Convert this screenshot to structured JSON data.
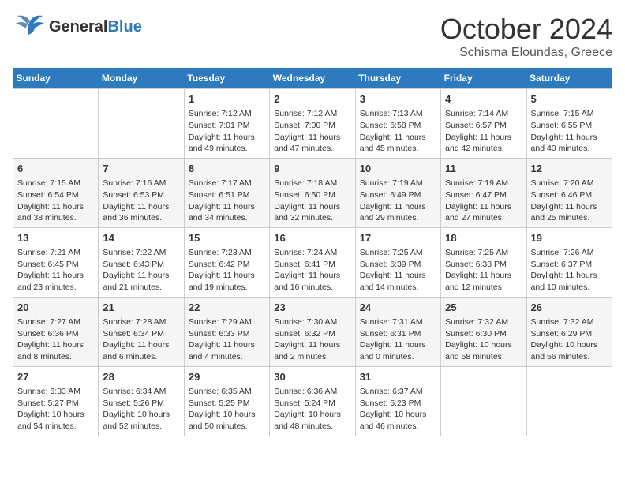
{
  "header": {
    "logo_general": "General",
    "logo_blue": "Blue",
    "month_title": "October 2024",
    "location": "Schisma Eloundas, Greece"
  },
  "weekdays": [
    "Sunday",
    "Monday",
    "Tuesday",
    "Wednesday",
    "Thursday",
    "Friday",
    "Saturday"
  ],
  "weeks": [
    [
      {
        "day": "",
        "sunrise": "",
        "sunset": "",
        "daylight": ""
      },
      {
        "day": "",
        "sunrise": "",
        "sunset": "",
        "daylight": ""
      },
      {
        "day": "1",
        "sunrise": "Sunrise: 7:12 AM",
        "sunset": "Sunset: 7:01 PM",
        "daylight": "Daylight: 11 hours and 49 minutes."
      },
      {
        "day": "2",
        "sunrise": "Sunrise: 7:12 AM",
        "sunset": "Sunset: 7:00 PM",
        "daylight": "Daylight: 11 hours and 47 minutes."
      },
      {
        "day": "3",
        "sunrise": "Sunrise: 7:13 AM",
        "sunset": "Sunset: 6:58 PM",
        "daylight": "Daylight: 11 hours and 45 minutes."
      },
      {
        "day": "4",
        "sunrise": "Sunrise: 7:14 AM",
        "sunset": "Sunset: 6:57 PM",
        "daylight": "Daylight: 11 hours and 42 minutes."
      },
      {
        "day": "5",
        "sunrise": "Sunrise: 7:15 AM",
        "sunset": "Sunset: 6:55 PM",
        "daylight": "Daylight: 11 hours and 40 minutes."
      }
    ],
    [
      {
        "day": "6",
        "sunrise": "Sunrise: 7:15 AM",
        "sunset": "Sunset: 6:54 PM",
        "daylight": "Daylight: 11 hours and 38 minutes."
      },
      {
        "day": "7",
        "sunrise": "Sunrise: 7:16 AM",
        "sunset": "Sunset: 6:53 PM",
        "daylight": "Daylight: 11 hours and 36 minutes."
      },
      {
        "day": "8",
        "sunrise": "Sunrise: 7:17 AM",
        "sunset": "Sunset: 6:51 PM",
        "daylight": "Daylight: 11 hours and 34 minutes."
      },
      {
        "day": "9",
        "sunrise": "Sunrise: 7:18 AM",
        "sunset": "Sunset: 6:50 PM",
        "daylight": "Daylight: 11 hours and 32 minutes."
      },
      {
        "day": "10",
        "sunrise": "Sunrise: 7:19 AM",
        "sunset": "Sunset: 6:49 PM",
        "daylight": "Daylight: 11 hours and 29 minutes."
      },
      {
        "day": "11",
        "sunrise": "Sunrise: 7:19 AM",
        "sunset": "Sunset: 6:47 PM",
        "daylight": "Daylight: 11 hours and 27 minutes."
      },
      {
        "day": "12",
        "sunrise": "Sunrise: 7:20 AM",
        "sunset": "Sunset: 6:46 PM",
        "daylight": "Daylight: 11 hours and 25 minutes."
      }
    ],
    [
      {
        "day": "13",
        "sunrise": "Sunrise: 7:21 AM",
        "sunset": "Sunset: 6:45 PM",
        "daylight": "Daylight: 11 hours and 23 minutes."
      },
      {
        "day": "14",
        "sunrise": "Sunrise: 7:22 AM",
        "sunset": "Sunset: 6:43 PM",
        "daylight": "Daylight: 11 hours and 21 minutes."
      },
      {
        "day": "15",
        "sunrise": "Sunrise: 7:23 AM",
        "sunset": "Sunset: 6:42 PM",
        "daylight": "Daylight: 11 hours and 19 minutes."
      },
      {
        "day": "16",
        "sunrise": "Sunrise: 7:24 AM",
        "sunset": "Sunset: 6:41 PM",
        "daylight": "Daylight: 11 hours and 16 minutes."
      },
      {
        "day": "17",
        "sunrise": "Sunrise: 7:25 AM",
        "sunset": "Sunset: 6:39 PM",
        "daylight": "Daylight: 11 hours and 14 minutes."
      },
      {
        "day": "18",
        "sunrise": "Sunrise: 7:25 AM",
        "sunset": "Sunset: 6:38 PM",
        "daylight": "Daylight: 11 hours and 12 minutes."
      },
      {
        "day": "19",
        "sunrise": "Sunrise: 7:26 AM",
        "sunset": "Sunset: 6:37 PM",
        "daylight": "Daylight: 11 hours and 10 minutes."
      }
    ],
    [
      {
        "day": "20",
        "sunrise": "Sunrise: 7:27 AM",
        "sunset": "Sunset: 6:36 PM",
        "daylight": "Daylight: 11 hours and 8 minutes."
      },
      {
        "day": "21",
        "sunrise": "Sunrise: 7:28 AM",
        "sunset": "Sunset: 6:34 PM",
        "daylight": "Daylight: 11 hours and 6 minutes."
      },
      {
        "day": "22",
        "sunrise": "Sunrise: 7:29 AM",
        "sunset": "Sunset: 6:33 PM",
        "daylight": "Daylight: 11 hours and 4 minutes."
      },
      {
        "day": "23",
        "sunrise": "Sunrise: 7:30 AM",
        "sunset": "Sunset: 6:32 PM",
        "daylight": "Daylight: 11 hours and 2 minutes."
      },
      {
        "day": "24",
        "sunrise": "Sunrise: 7:31 AM",
        "sunset": "Sunset: 6:31 PM",
        "daylight": "Daylight: 11 hours and 0 minutes."
      },
      {
        "day": "25",
        "sunrise": "Sunrise: 7:32 AM",
        "sunset": "Sunset: 6:30 PM",
        "daylight": "Daylight: 10 hours and 58 minutes."
      },
      {
        "day": "26",
        "sunrise": "Sunrise: 7:32 AM",
        "sunset": "Sunset: 6:29 PM",
        "daylight": "Daylight: 10 hours and 56 minutes."
      }
    ],
    [
      {
        "day": "27",
        "sunrise": "Sunrise: 6:33 AM",
        "sunset": "Sunset: 5:27 PM",
        "daylight": "Daylight: 10 hours and 54 minutes."
      },
      {
        "day": "28",
        "sunrise": "Sunrise: 6:34 AM",
        "sunset": "Sunset: 5:26 PM",
        "daylight": "Daylight: 10 hours and 52 minutes."
      },
      {
        "day": "29",
        "sunrise": "Sunrise: 6:35 AM",
        "sunset": "Sunset: 5:25 PM",
        "daylight": "Daylight: 10 hours and 50 minutes."
      },
      {
        "day": "30",
        "sunrise": "Sunrise: 6:36 AM",
        "sunset": "Sunset: 5:24 PM",
        "daylight": "Daylight: 10 hours and 48 minutes."
      },
      {
        "day": "31",
        "sunrise": "Sunrise: 6:37 AM",
        "sunset": "Sunset: 5:23 PM",
        "daylight": "Daylight: 10 hours and 46 minutes."
      },
      {
        "day": "",
        "sunrise": "",
        "sunset": "",
        "daylight": ""
      },
      {
        "day": "",
        "sunrise": "",
        "sunset": "",
        "daylight": ""
      }
    ]
  ]
}
